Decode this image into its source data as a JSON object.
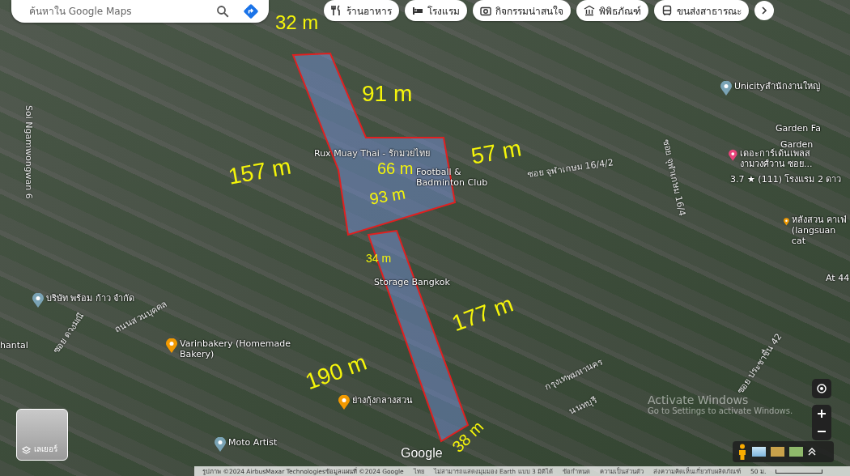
{
  "search": {
    "placeholder": "ค้นหาใน Google Maps"
  },
  "chips": [
    {
      "label": "ร้านอาหาร",
      "kind": "restaurant"
    },
    {
      "label": "โรงแรม",
      "kind": "hotel"
    },
    {
      "label": "กิจกรรมน่าสนใจ",
      "kind": "camera"
    },
    {
      "label": "พิพิธภัณฑ์",
      "kind": "museum"
    },
    {
      "label": "ขนส่งสาธารณะ",
      "kind": "transit"
    }
  ],
  "places": [
    {
      "name": "Rux Muay Thai - รักมวยไทย",
      "kind": "none"
    },
    {
      "name": "Football & Badminton Club",
      "kind": "none"
    },
    {
      "name": "Storage Bangkok",
      "kind": "none"
    },
    {
      "name": "Unicityสำนักงานใหญ่",
      "kind": "generic"
    },
    {
      "name": "Garden Fa",
      "kind": "none"
    },
    {
      "name": "Garden",
      "kind": "none"
    },
    {
      "name": "เดอะการ์เด้นเพลส งามวงศ์วาน ซอย...",
      "kind": "hotel"
    },
    {
      "name": "3.7 ★ (111) โรงแรม 2 ดาว",
      "kind": "none"
    },
    {
      "name": "หลังสวน คาเฟ่ (langsuan cat",
      "kind": "food"
    },
    {
      "name": "At 44",
      "kind": "none"
    },
    {
      "name": "บริษัท พร้อม ก้าว จำกัด",
      "kind": "generic"
    },
    {
      "name": "hantal",
      "kind": "none"
    },
    {
      "name": "Varinbakery (Homemade Bakery)",
      "kind": "food"
    },
    {
      "name": "ย่างกุ้งกลางสวน",
      "kind": "food"
    },
    {
      "name": "Moto Artist",
      "kind": "generic"
    }
  ],
  "streets": [
    "ถนนสวนบุคคล",
    "ซอย ดวงมณี",
    "Soi Ngamwongwan 6",
    "ซอย จุฬาเกษม 16/4/2",
    "ซอย จุฬาเกษม 16/4",
    "นนทบุรี",
    "กรุงเทพมหานคร",
    "ซอย ประชาชื่น 42"
  ],
  "measurements": [
    "32 m",
    "91 m",
    "157 m",
    "66 m",
    "57 m",
    "93 m",
    "34 m",
    "177 m",
    "190 m",
    "38 m"
  ],
  "watermark_os": [
    "Activate Windows",
    "Go to Settings to activate Windows."
  ],
  "layers": {
    "label": "เลเยอร์"
  },
  "logo": "Google",
  "footer": {
    "attribution": "รูปภาพ ©2024 AirbusMaxar Technologiesข้อมูลแผนที่ ©2024 Google",
    "links": [
      "ไทย",
      "ไม่สามารถแสดงมุมมอง Earth แบบ 3 มิติได้",
      "ข้อกำหนด",
      "ความเป็นส่วนตัว",
      "ส่งความคิดเห็นเกี่ยวกับผลิตภัณฑ์"
    ],
    "scale": "50 ม."
  }
}
